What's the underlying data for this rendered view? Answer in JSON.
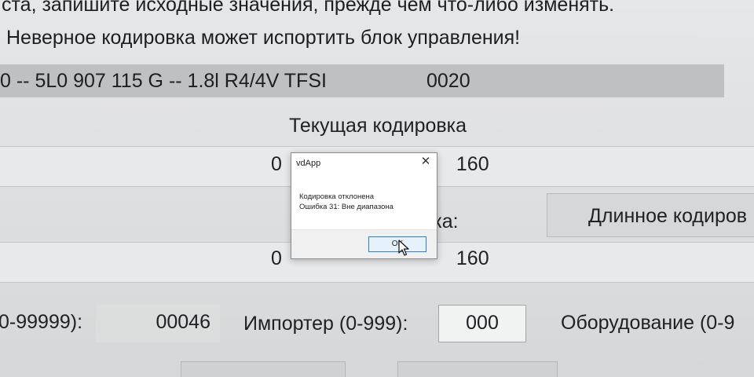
{
  "warning": {
    "line1": "ста, запишите исходные значения, прежде чем что-либо изменять.",
    "line2": "Неверное кодировка может испортить блок управления!"
  },
  "ecu": {
    "ident": "0 -- 5L0 907 115 G -- 1.8l R4/4V TFSI",
    "code": "0020"
  },
  "current_coding": {
    "title": "Текущая кодировка",
    "value_prefix": "0",
    "value_suffix": "160"
  },
  "new_coding": {
    "label_fragment": "вка:",
    "value_prefix": "0",
    "value_suffix": "160"
  },
  "long_coding_button": "Длинное кодиров",
  "fields": {
    "workshop_label": "0-99999):",
    "workshop_value": "00046",
    "importer_label": "Импортер (0-999):",
    "importer_value": "000",
    "equipment_label": "Оборудование (0-9"
  },
  "dialog": {
    "title": "vdApp",
    "message_line1": "Кодировка отклонена",
    "message_line2": "Ошибка 31: Вне диапазона",
    "ok_label": "OK"
  },
  "icons": {
    "close": "close-icon",
    "cursor": "mouse-cursor-icon"
  },
  "colors": {
    "ecu_bar": "#bfc0c1",
    "ok_border": "#2b7fd1",
    "ok_fill": "#e5f1fb"
  }
}
